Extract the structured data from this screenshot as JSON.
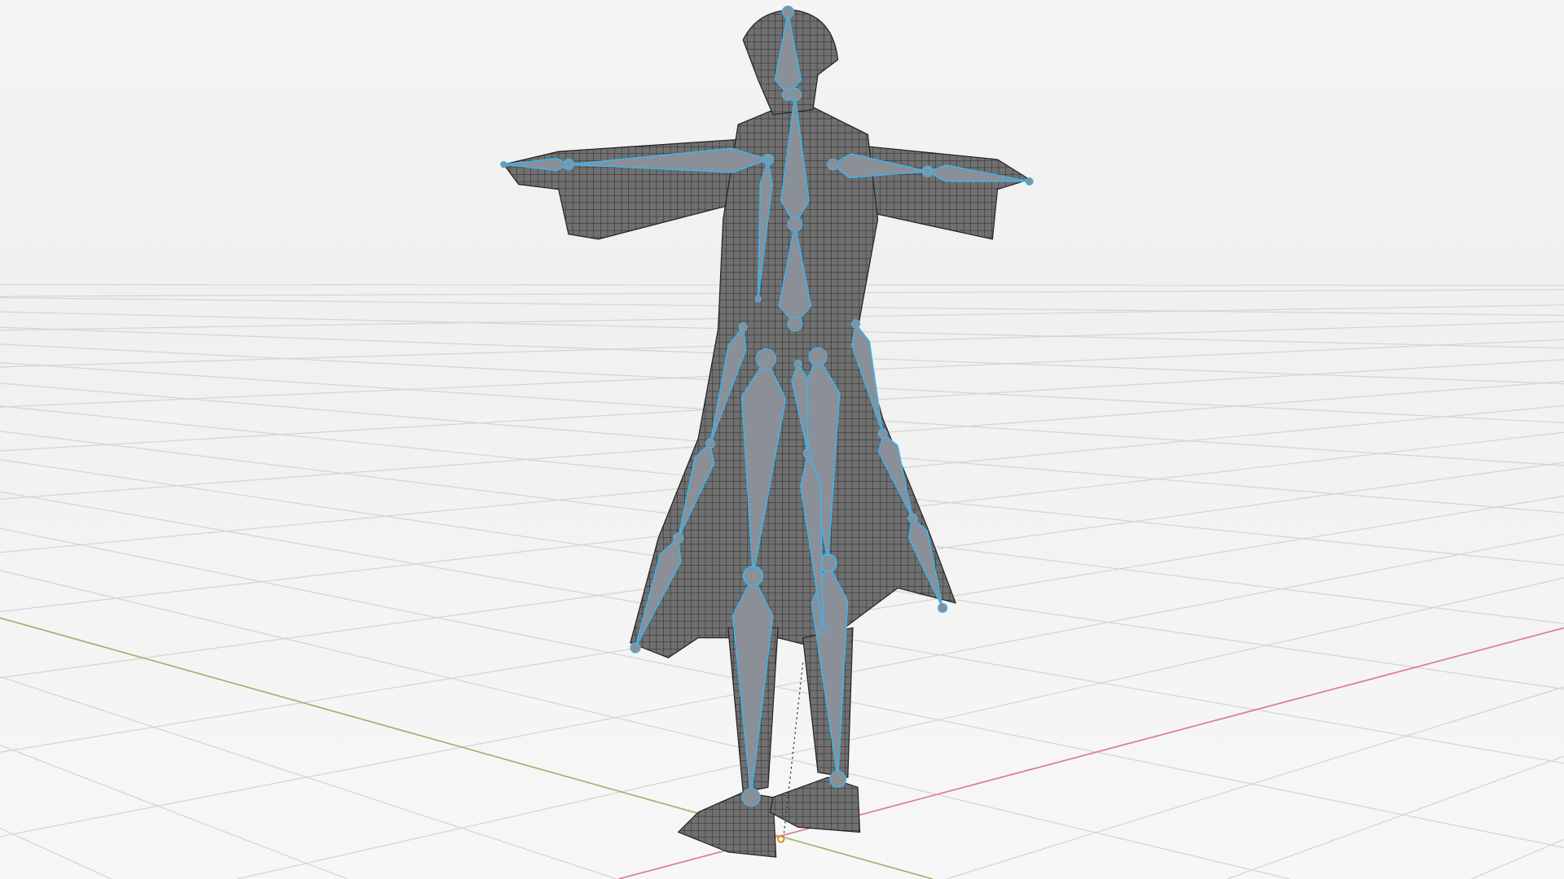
{
  "viewport": {
    "mode": "3d-viewport",
    "background_color": "#f6f6f6",
    "grid_color": "#d4d4d4",
    "x_axis_color": "#d8808e",
    "y_axis_color": "#a8b070",
    "mesh_color": "#6c6c6c",
    "mesh_wire_color": "#2a2a2a",
    "bone_fill_color": "#8b8f97",
    "bone_outline_color": "#3fb4ec"
  }
}
